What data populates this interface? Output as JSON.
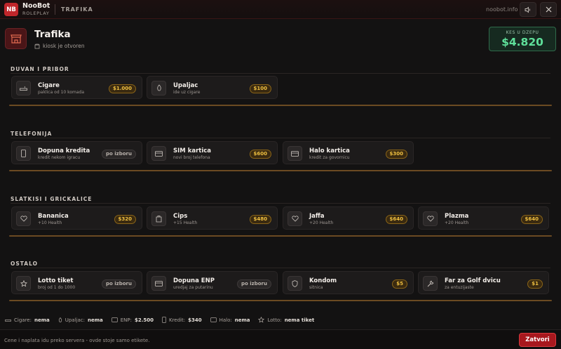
{
  "topbar": {
    "logo": "NB",
    "brand_name": "NooBot",
    "brand_sub": "ROLEPLAY",
    "title": "TRAFIKA",
    "domain": "noobot.info",
    "sound_icon": "speaker-icon",
    "close_icon": "close-icon"
  },
  "header": {
    "icon": "store-icon",
    "title": "Trafika",
    "status": "kiosk je otvoren"
  },
  "wallet": {
    "label": "KES U DZEPU",
    "value": "$4.820"
  },
  "sections": [
    {
      "title": "DUVAN I PRIBOR",
      "items": [
        {
          "icon": "cigarette-icon",
          "name": "Cigare",
          "desc": "paklica od 10 komada",
          "price": "$1.000"
        },
        {
          "icon": "lighter-icon",
          "name": "Upaljac",
          "desc": "ide uz cigare",
          "price": "$100"
        }
      ]
    },
    {
      "title": "TELEFONIJA",
      "items": [
        {
          "icon": "phone-icon",
          "name": "Dopuna kredita",
          "desc": "kredit nekom igracu",
          "price": "po izboru"
        },
        {
          "icon": "card-icon",
          "name": "SIM kartica",
          "desc": "novi broj telefona",
          "price": "$600"
        },
        {
          "icon": "card-icon",
          "name": "Halo kartica",
          "desc": "kredit za govornicu",
          "price": "$300"
        }
      ]
    },
    {
      "title": "SLATKISI I GRICKALICE",
      "items": [
        {
          "icon": "heart-icon",
          "name": "Bananica",
          "desc": "+10 Health",
          "price": "$320"
        },
        {
          "icon": "bag-icon",
          "name": "Cips",
          "desc": "+15 Health",
          "price": "$480"
        },
        {
          "icon": "heart-icon",
          "name": "Jaffa",
          "desc": "+20 Health",
          "price": "$640"
        },
        {
          "icon": "heart-icon",
          "name": "Plazma",
          "desc": "+20 Health",
          "price": "$640"
        }
      ]
    },
    {
      "title": "OSTALO",
      "items": [
        {
          "icon": "star-icon",
          "name": "Lotto tiket",
          "desc": "broj od 1 do 1000",
          "price": "po izboru"
        },
        {
          "icon": "card-icon",
          "name": "Dopuna ENP",
          "desc": "uredjaj za putarinu",
          "price": "po izboru"
        },
        {
          "icon": "shield-icon",
          "name": "Kondom",
          "desc": "sitnica",
          "price": "$5"
        },
        {
          "icon": "wrench-icon",
          "name": "Far za Golf dvicu",
          "desc": "za entuzijaste",
          "price": "$1"
        }
      ]
    }
  ],
  "status": [
    {
      "icon": "cigarette-icon",
      "label": "Cigare:",
      "value": "nema"
    },
    {
      "icon": "lighter-icon",
      "label": "Upaljac:",
      "value": "nema"
    },
    {
      "icon": "card-icon",
      "label": "ENP:",
      "value": "$2.500"
    },
    {
      "icon": "phone-icon",
      "label": "Kredit:",
      "value": "$340"
    },
    {
      "icon": "card-icon",
      "label": "Halo:",
      "value": "nema"
    },
    {
      "icon": "star-icon",
      "label": "Lotto:",
      "value": "nema tiket"
    }
  ],
  "footer": {
    "note": "Cene i naplata idu preko servera - ovde stoje samo etikete.",
    "close_label": "Zatvori"
  },
  "colors": {
    "accent_red": "#c0262b",
    "price_gold": "#f0c040",
    "wallet_green": "#5fe09a"
  }
}
